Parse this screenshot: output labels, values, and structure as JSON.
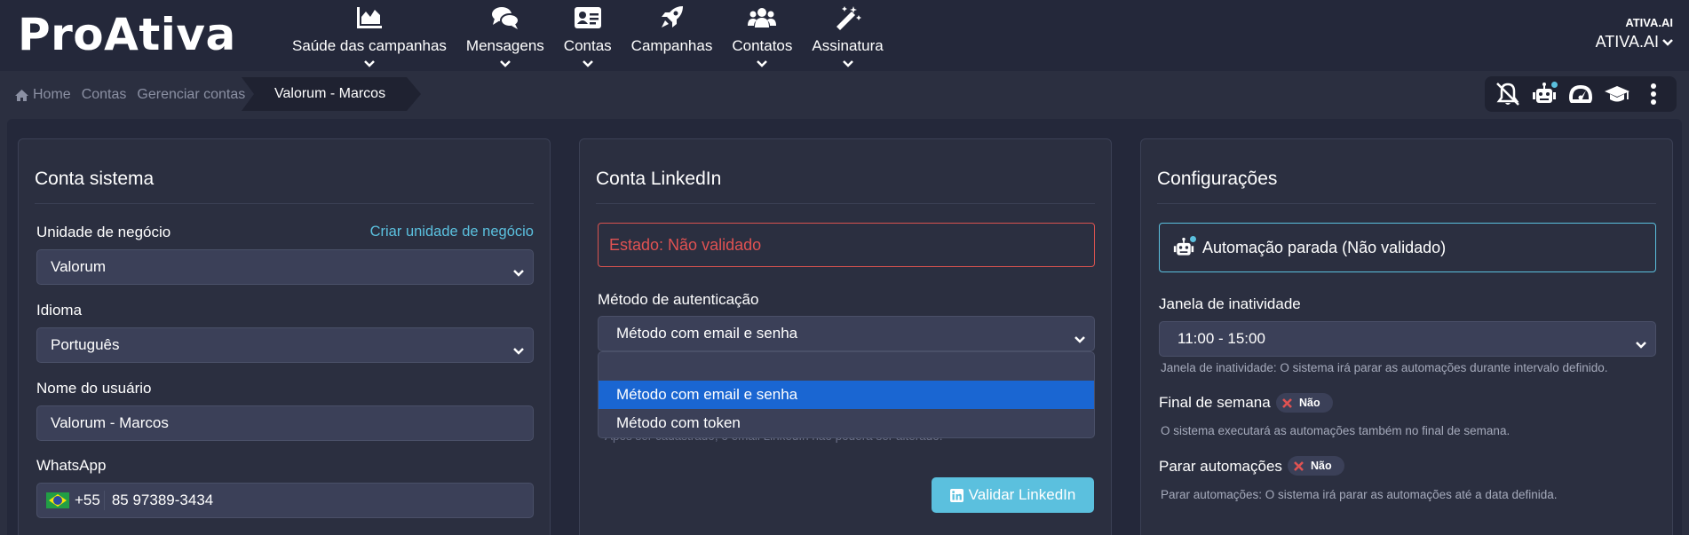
{
  "app": {
    "logo": "ProAtiva"
  },
  "nav": [
    {
      "id": "saude",
      "label": "Saúde das campanhas",
      "icon": "area-chart-icon",
      "dropdown": true
    },
    {
      "id": "mensagens",
      "label": "Mensagens",
      "icon": "comments-icon",
      "dropdown": true
    },
    {
      "id": "contas",
      "label": "Contas",
      "icon": "address-card-icon",
      "dropdown": true
    },
    {
      "id": "campanhas",
      "label": "Campanhas",
      "icon": "rocket-icon",
      "dropdown": false
    },
    {
      "id": "contatos",
      "label": "Contatos",
      "icon": "users-icon",
      "dropdown": true
    },
    {
      "id": "assinatura",
      "label": "Assinatura",
      "icon": "magic-wand-icon",
      "dropdown": true
    }
  ],
  "org": {
    "small": "ATIVA.AI",
    "main": "ATIVA.AI"
  },
  "breadcrumb": {
    "home": "Home",
    "items": [
      "Contas",
      "Gerenciar contas"
    ],
    "active": "Valorum - Marcos"
  },
  "toolbar": [
    "bell-slash-icon",
    "robot-icon",
    "tachometer-icon",
    "graduation-cap-icon",
    "ellipsis-vertical-icon"
  ],
  "conta_sistema": {
    "title": "Conta sistema",
    "unidade_label": "Unidade de negócio",
    "unidade_link": "Criar unidade de negócio",
    "unidade_value": "Valorum",
    "idioma_label": "Idioma",
    "idioma_value": "Português",
    "nome_label": "Nome do usuário",
    "nome_value": "Valorum - Marcos",
    "whatsapp_label": "WhatsApp",
    "whatsapp_code": "+55",
    "whatsapp_number": "85 97389-3434"
  },
  "conta_linkedin": {
    "title": "Conta LinkedIn",
    "estado": "Estado: Não validado",
    "metodo_label": "Método de autenticação",
    "metodo_value": "Método com email e senha",
    "options": [
      "",
      "Método com email e senha",
      "Método com token"
    ],
    "hint": "Após ser cadastrado, o email LinkedIn não poderá ser alterado.",
    "validar_button": "Validar LinkedIn"
  },
  "configuracoes": {
    "title": "Configurações",
    "automacao_status": "Automação parada (Não validado)",
    "janela_label": "Janela de inatividade",
    "janela_value": "11:00 - 15:00",
    "janela_hint": "Janela de inatividade: O sistema irá parar as automações durante intervalo definido.",
    "final_label": "Final de semana",
    "final_toggle": "Não",
    "final_hint": "O sistema executará as automações também no final de semana.",
    "parar_label": "Parar automações",
    "parar_toggle": "Não",
    "parar_hint": "Parar automações: O sistema irá parar as automações até a data definida."
  },
  "colors": {
    "accent": "#5bc0de",
    "danger": "#d9534f",
    "selected": "#1a66d2",
    "navbar": "#24283a"
  }
}
